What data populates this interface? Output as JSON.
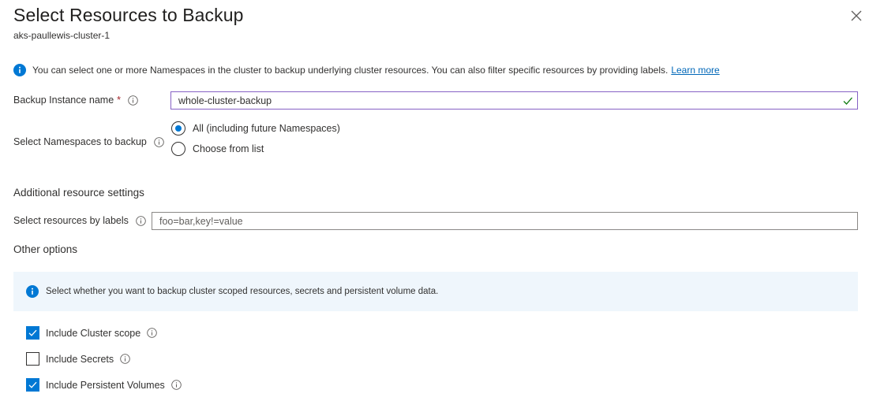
{
  "header": {
    "title": "Select Resources to Backup",
    "subtitle": "aks-paullewis-cluster-1",
    "close_icon": "close-icon"
  },
  "info": {
    "text": "You can select one or more Namespaces in the cluster to backup underlying cluster resources. You can also filter specific resources by providing labels.",
    "link": "Learn more",
    "icon": "info-icon"
  },
  "backup_instance": {
    "label": "Backup Instance name",
    "required_marker": "*",
    "value": "whole-cluster-backup",
    "valid": true
  },
  "namespaces": {
    "label": "Select Namespaces to backup",
    "options": [
      {
        "label": "All (including future Namespaces)",
        "selected": true
      },
      {
        "label": "Choose from list",
        "selected": false
      }
    ]
  },
  "additional": {
    "heading": "Additional resource settings",
    "labels_label": "Select resources by labels",
    "labels_placeholder": "foo=bar,key!=value",
    "labels_value": ""
  },
  "other": {
    "heading": "Other options",
    "notice": "Select whether you want to backup cluster scoped resources, secrets and persistent volume data.",
    "checkboxes": [
      {
        "label": "Include Cluster scope",
        "checked": true
      },
      {
        "label": "Include Secrets",
        "checked": false
      },
      {
        "label": "Include Persistent Volumes",
        "checked": true
      }
    ]
  },
  "colors": {
    "accent": "#0078d4",
    "link": "#0067b8",
    "valid_check": "#107c10",
    "notice_bg": "#eff6fc",
    "focus_border": "#8661c5"
  }
}
